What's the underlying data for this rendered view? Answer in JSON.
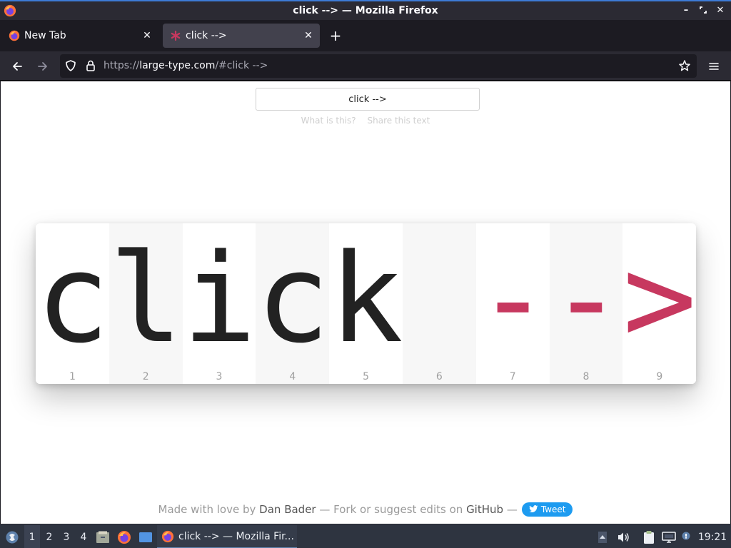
{
  "window": {
    "title": "click --> — Mozilla Firefox"
  },
  "tabs": [
    {
      "label": "New Tab",
      "active": false
    },
    {
      "label": "click -->",
      "active": true
    }
  ],
  "urlbar": {
    "scheme": "https://",
    "host": "large-type.com",
    "path": "/#click -->"
  },
  "page": {
    "input_value": "click -->",
    "links": [
      "What is this?",
      "Share this text"
    ],
    "characters": [
      {
        "glyph": "c",
        "number": "1",
        "type": "letter"
      },
      {
        "glyph": "l",
        "number": "2",
        "type": "letter"
      },
      {
        "glyph": "i",
        "number": "3",
        "type": "letter"
      },
      {
        "glyph": "c",
        "number": "4",
        "type": "letter"
      },
      {
        "glyph": "k",
        "number": "5",
        "type": "letter"
      },
      {
        "glyph": " ",
        "number": "6",
        "type": "space"
      },
      {
        "glyph": "-",
        "number": "7",
        "type": "symbol"
      },
      {
        "glyph": "-",
        "number": "8",
        "type": "symbol"
      },
      {
        "glyph": ">",
        "number": "9",
        "type": "symbol"
      }
    ],
    "footer": {
      "made_with": "Made with love by",
      "author": "Dan Bader",
      "fork_text": "— Fork or suggest edits on",
      "github": "GitHub",
      "dash": "—",
      "tweet": "Tweet"
    }
  },
  "taskbar": {
    "workspaces": [
      "1",
      "2",
      "3",
      "4"
    ],
    "window_label": "click --> — Mozilla Fir...",
    "clock": "19:21"
  },
  "colors": {
    "accent": "#3d7bd6",
    "symbol": "#c7385f",
    "tweet": "#1d9bf0"
  }
}
